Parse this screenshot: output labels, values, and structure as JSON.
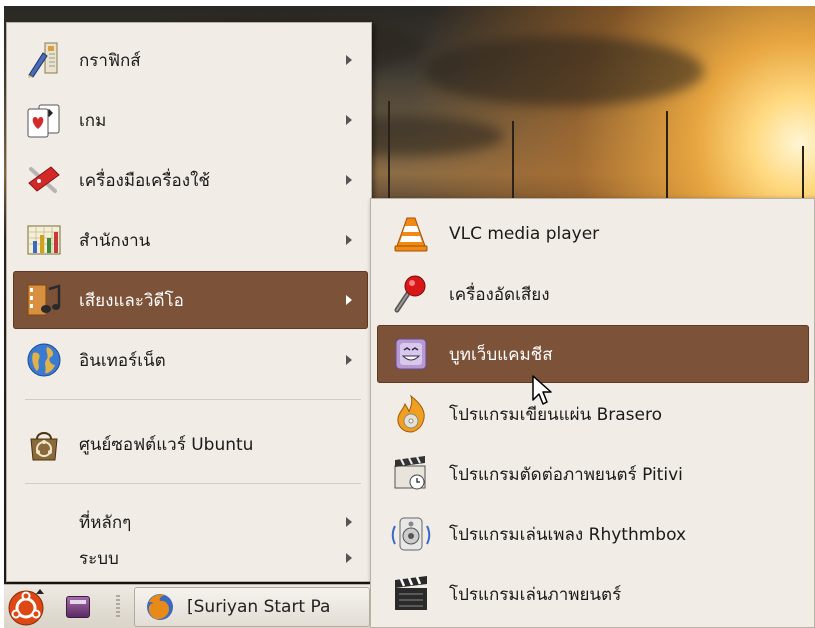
{
  "main_menu": {
    "items": [
      {
        "label": "กราฟิกส์",
        "icon": "graphics-icon",
        "has_submenu": true
      },
      {
        "label": "เกม",
        "icon": "games-icon",
        "has_submenu": true
      },
      {
        "label": "เครื่องมือเครื่องใช้",
        "icon": "accessories-icon",
        "has_submenu": true
      },
      {
        "label": "สำนักงาน",
        "icon": "office-icon",
        "has_submenu": true
      },
      {
        "label": "เสียงและวิดีโอ",
        "icon": "sound-video-icon",
        "has_submenu": true,
        "active": true
      },
      {
        "label": "อินเทอร์เน็ต",
        "icon": "internet-icon",
        "has_submenu": true
      }
    ],
    "software_center": {
      "label": "ศูนย์ซอฟต์แวร์ Ubuntu",
      "icon": "software-center-icon"
    },
    "places": {
      "label": "ที่หลักๆ"
    },
    "system": {
      "label": "ระบบ"
    }
  },
  "sub_menu": {
    "items": [
      {
        "label": "VLC media player",
        "icon": "vlc-icon"
      },
      {
        "label": "เครื่องอัดเสียง",
        "icon": "microphone-icon"
      },
      {
        "label": "บูทเว็บแคมชีส",
        "icon": "cheese-webcam-icon",
        "active": true
      },
      {
        "label": "โปรแกรมเขียนแผ่น Brasero",
        "icon": "brasero-icon"
      },
      {
        "label": "โปรแกรมตัดต่อภาพยนตร์ Pitivi",
        "icon": "pitivi-icon"
      },
      {
        "label": "โปรแกรมเล่นเพลง Rhythmbox",
        "icon": "rhythmbox-icon"
      },
      {
        "label": "โปรแกรมเล่นภาพยนตร์",
        "icon": "movie-player-icon"
      }
    ]
  },
  "panel": {
    "task_button": {
      "label": "[Suriyan Start Pa"
    }
  },
  "colors": {
    "menu_bg": "#f1ede6",
    "highlight": "#7c5238",
    "highlight_text": "#ffffff"
  }
}
